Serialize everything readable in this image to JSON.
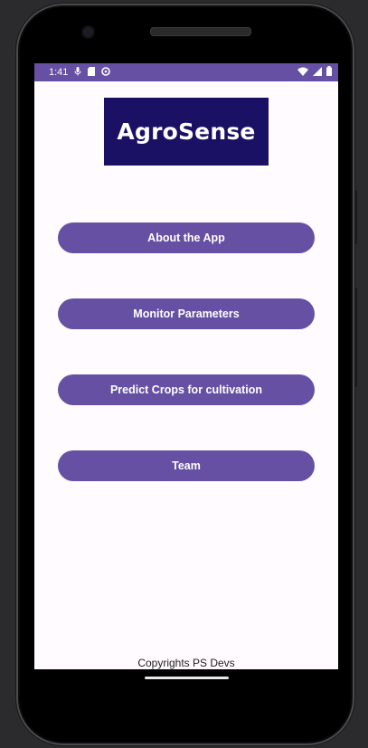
{
  "status_bar": {
    "time": "1:41",
    "icons_left": [
      "mic-icon",
      "sim-card-icon",
      "sync-icon"
    ],
    "icons_right": [
      "wifi-icon",
      "signal-icon",
      "battery-icon"
    ]
  },
  "app": {
    "logo_text": "AgroSense",
    "buttons": [
      {
        "label": "About the App"
      },
      {
        "label": "Monitor Parameters"
      },
      {
        "label": "Predict Crops for cultivation"
      },
      {
        "label": "Team"
      }
    ],
    "footer": "Copyrights PS Devs"
  },
  "colors": {
    "accent": "#6650a4",
    "logo_bg": "#1a1164",
    "screen_bg": "#fffbfe"
  }
}
